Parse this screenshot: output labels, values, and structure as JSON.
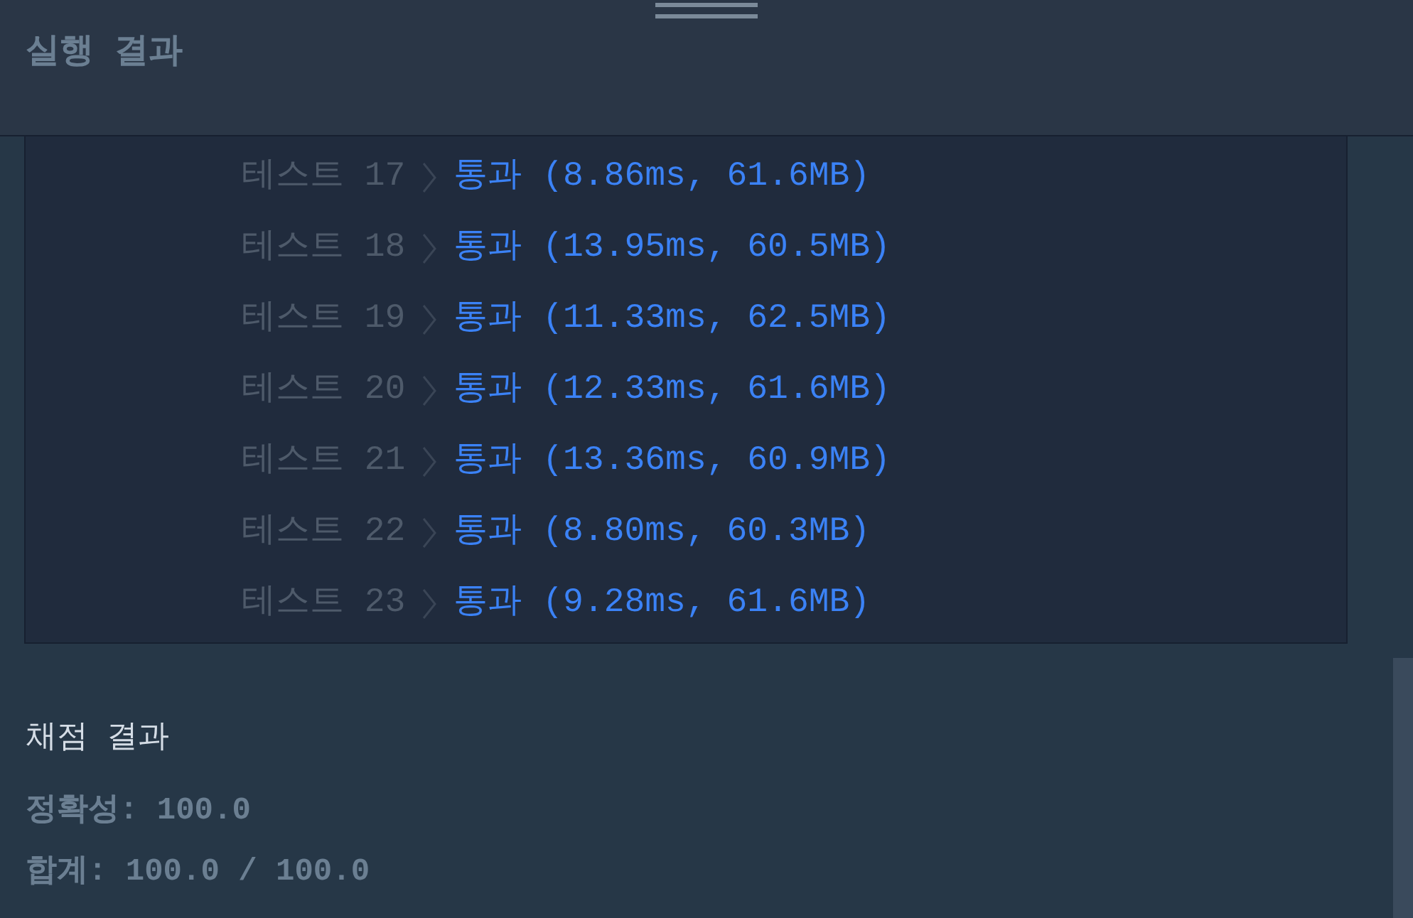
{
  "panel": {
    "title": "실행 결과"
  },
  "tests": [
    {
      "label": "테스트 17",
      "result": "통과 (8.86ms, 61.6MB)"
    },
    {
      "label": "테스트 18",
      "result": "통과 (13.95ms, 60.5MB)"
    },
    {
      "label": "테스트 19",
      "result": "통과 (11.33ms, 62.5MB)"
    },
    {
      "label": "테스트 20",
      "result": "통과 (12.33ms, 61.6MB)"
    },
    {
      "label": "테스트 21",
      "result": "통과 (13.36ms, 60.9MB)"
    },
    {
      "label": "테스트 22",
      "result": "통과 (8.80ms, 60.3MB)"
    },
    {
      "label": "테스트 23",
      "result": "통과 (9.28ms, 61.6MB)"
    }
  ],
  "grading": {
    "title": "채점 결과",
    "lines": [
      "정확성: 100.0",
      "합계: 100.0 / 100.0"
    ]
  }
}
